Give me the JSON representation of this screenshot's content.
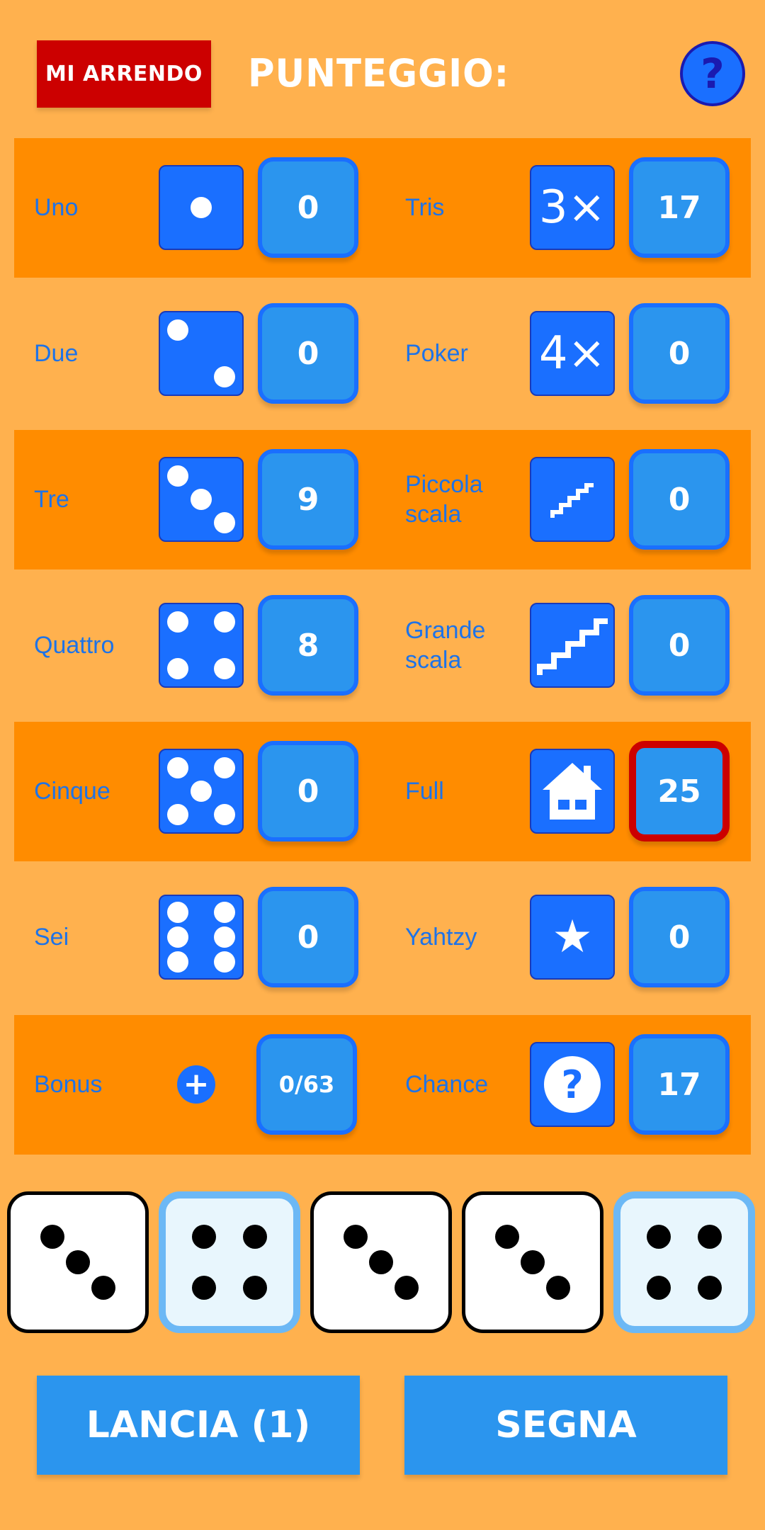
{
  "header": {
    "surrender_label": "MI ARRENDO",
    "score_label": "PUNTEGGIO:",
    "help_icon": "question-mark-icon",
    "help_glyph": "?"
  },
  "colors": {
    "background": "#ffb14e",
    "row_highlight": "#ff8c00",
    "accent_blue": "#1a6fff",
    "score_box": "#2b95ee",
    "surrender_red": "#cc0000",
    "selected_border": "#cc0000"
  },
  "upper": [
    {
      "label": "Uno",
      "icon": "die-face-1-icon",
      "score": "0"
    },
    {
      "label": "Due",
      "icon": "die-face-2-icon",
      "score": "0"
    },
    {
      "label": "Tre",
      "icon": "die-face-3-icon",
      "score": "9"
    },
    {
      "label": "Quattro",
      "icon": "die-face-4-icon",
      "score": "8"
    },
    {
      "label": "Cinque",
      "icon": "die-face-5-icon",
      "score": "0"
    },
    {
      "label": "Sei",
      "icon": "die-face-6-icon",
      "score": "0"
    },
    {
      "label": "Bonus",
      "icon": "plus-circle-icon",
      "score": "0/63"
    }
  ],
  "lower": [
    {
      "label": "Tris",
      "icon": "three-of-a-kind-icon",
      "glyph": "3×",
      "score": "17"
    },
    {
      "label": "Poker",
      "icon": "four-of-a-kind-icon",
      "glyph": "4×",
      "score": "0"
    },
    {
      "label": "Piccola scala",
      "icon": "small-stairs-icon",
      "score": "0"
    },
    {
      "label": "Grande scala",
      "icon": "large-stairs-icon",
      "score": "0"
    },
    {
      "label": "Full",
      "icon": "house-icon",
      "score": "25",
      "selected": true
    },
    {
      "label": "Yahtzy",
      "icon": "star-icon",
      "glyph": "★",
      "score": "0"
    },
    {
      "label": "Chance",
      "icon": "question-circle-icon",
      "glyph": "?",
      "score": "17"
    }
  ],
  "dice": [
    {
      "value": 3,
      "held": false
    },
    {
      "value": 4,
      "held": true
    },
    {
      "value": 3,
      "held": false
    },
    {
      "value": 3,
      "held": false
    },
    {
      "value": 4,
      "held": true
    }
  ],
  "actions": {
    "roll_label": "LANCIA (1)",
    "score_label": "SEGNA"
  }
}
